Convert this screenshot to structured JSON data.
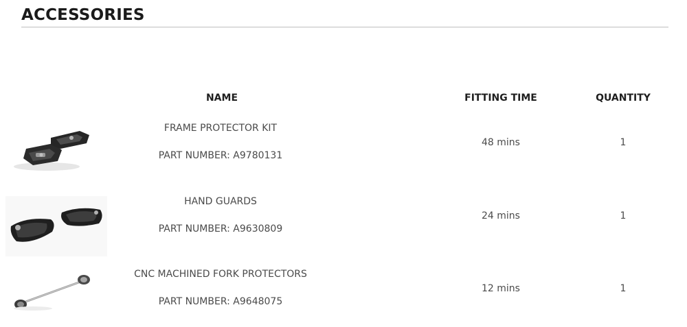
{
  "heading": "ACCESSORIES",
  "table": {
    "headers": {
      "name": "NAME",
      "fitting_time": "FITTING TIME",
      "quantity": "QUANTITY"
    },
    "rows": [
      {
        "name": "FRAME PROTECTOR KIT",
        "part_number": "PART NUMBER: A9780131",
        "fitting_time": "48 mins",
        "quantity": "1",
        "image": "frame-protector-kit-image"
      },
      {
        "name": "HAND GUARDS",
        "part_number": "PART NUMBER: A9630809",
        "fitting_time": "24 mins",
        "quantity": "1",
        "image": "hand-guards-image"
      },
      {
        "name": "CNC MACHINED FORK PROTECTORS",
        "part_number": "PART NUMBER: A9648075",
        "fitting_time": "12 mins",
        "quantity": "1",
        "image": "fork-protectors-image"
      }
    ]
  }
}
